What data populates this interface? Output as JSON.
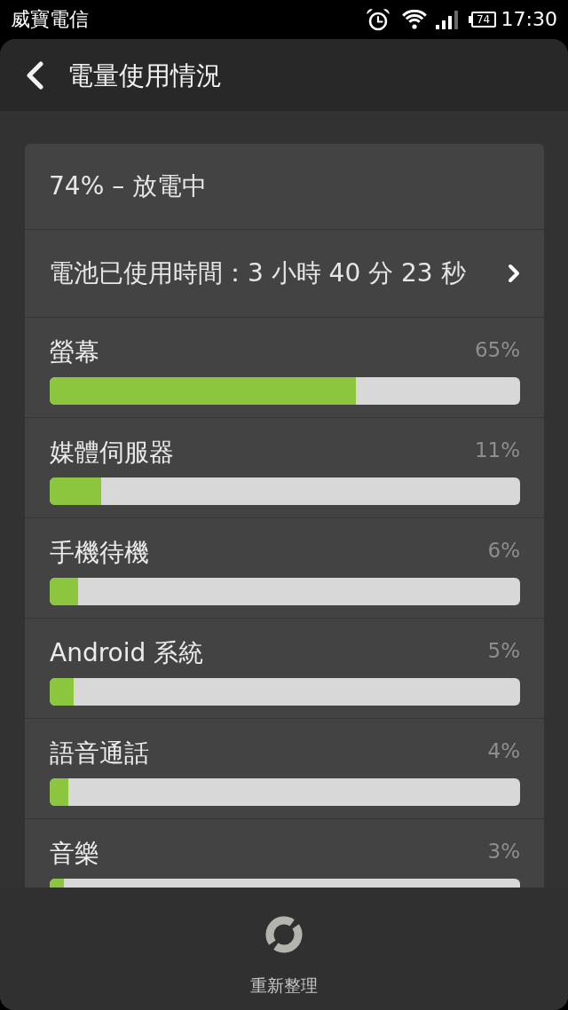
{
  "status_bar": {
    "carrier": "威寶電信",
    "battery": "74",
    "time": "17:30"
  },
  "header": {
    "title": "電量使用情況"
  },
  "summary": {
    "status": "74% – 放電中",
    "usage_time": "電池已使用時間：3 小時 40 分 23 秒"
  },
  "apps": [
    {
      "name": "螢幕",
      "percent": "65%",
      "level": 0.65
    },
    {
      "name": "媒體伺服器",
      "percent": "11%",
      "level": 0.11
    },
    {
      "name": "手機待機",
      "percent": "6%",
      "level": 0.06
    },
    {
      "name": "Android 系統",
      "percent": "5%",
      "level": 0.05
    },
    {
      "name": "語音通話",
      "percent": "4%",
      "level": 0.04
    },
    {
      "name": "音樂",
      "percent": "3%",
      "level": 0.03
    }
  ],
  "footer": {
    "refresh": "重新整理"
  }
}
